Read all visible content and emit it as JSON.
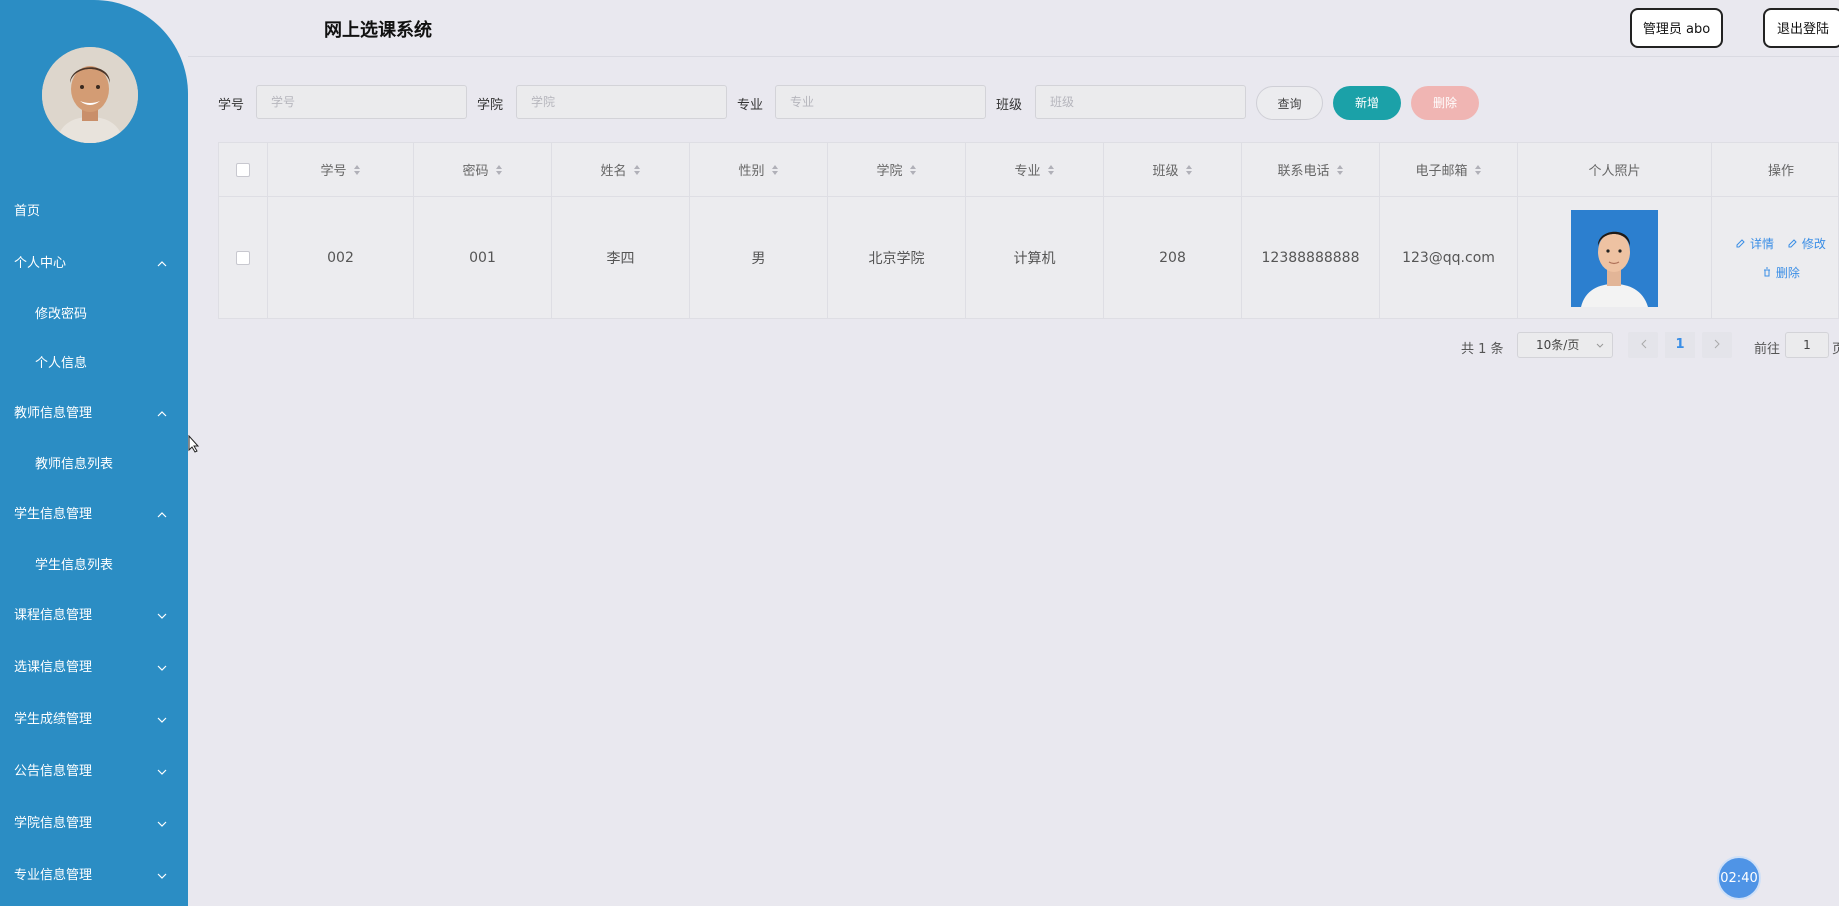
{
  "app": {
    "title": "网上选课系统"
  },
  "header": {
    "admin_label": "管理员 abo",
    "logout_label": "退出登陆"
  },
  "sidebar": {
    "items": [
      {
        "label": "首页",
        "chevron": "none"
      },
      {
        "label": "个人中心",
        "chevron": "up"
      },
      {
        "label": "修改密码",
        "sub": true
      },
      {
        "label": "个人信息",
        "sub": true
      },
      {
        "label": "教师信息管理",
        "chevron": "up"
      },
      {
        "label": "教师信息列表",
        "sub": true
      },
      {
        "label": "学生信息管理",
        "chevron": "up"
      },
      {
        "label": "学生信息列表",
        "sub": true
      },
      {
        "label": "课程信息管理",
        "chevron": "down"
      },
      {
        "label": "选课信息管理",
        "chevron": "down"
      },
      {
        "label": "学生成绩管理",
        "chevron": "down"
      },
      {
        "label": "公告信息管理",
        "chevron": "down"
      },
      {
        "label": "学院信息管理",
        "chevron": "down"
      },
      {
        "label": "专业信息管理",
        "chevron": "down"
      }
    ]
  },
  "search": {
    "fields": [
      {
        "label": "学号",
        "placeholder": "学号",
        "value": ""
      },
      {
        "label": "学院",
        "placeholder": "学院",
        "value": ""
      },
      {
        "label": "专业",
        "placeholder": "专业",
        "value": ""
      },
      {
        "label": "班级",
        "placeholder": "班级",
        "value": ""
      }
    ],
    "query_label": "查询",
    "add_label": "新增",
    "delete_label": "删除"
  },
  "table": {
    "columns": [
      "学号",
      "密码",
      "姓名",
      "性别",
      "学院",
      "专业",
      "班级",
      "联系电话",
      "电子邮箱",
      "个人照片",
      "操作"
    ],
    "rows": [
      {
        "cells": [
          "002",
          "001",
          "李四",
          "男",
          "北京学院",
          "计算机",
          "208",
          "12388888888",
          "123@qq.com"
        ],
        "actions": {
          "detail": "详情",
          "edit": "修改",
          "delete": "删除"
        }
      }
    ]
  },
  "pagination": {
    "total_text": "共 1 条",
    "page_size": "10条/页",
    "current_page": "1",
    "goto_label": "前往",
    "goto_value": "1",
    "page_suffix": "页"
  },
  "timer": {
    "text": "02:40"
  },
  "colors": {
    "sidebar": "#2b8dc4",
    "add_button": "#1ba1a8",
    "delete_button": "#f0b5b3",
    "link": "#3a8ee6"
  }
}
